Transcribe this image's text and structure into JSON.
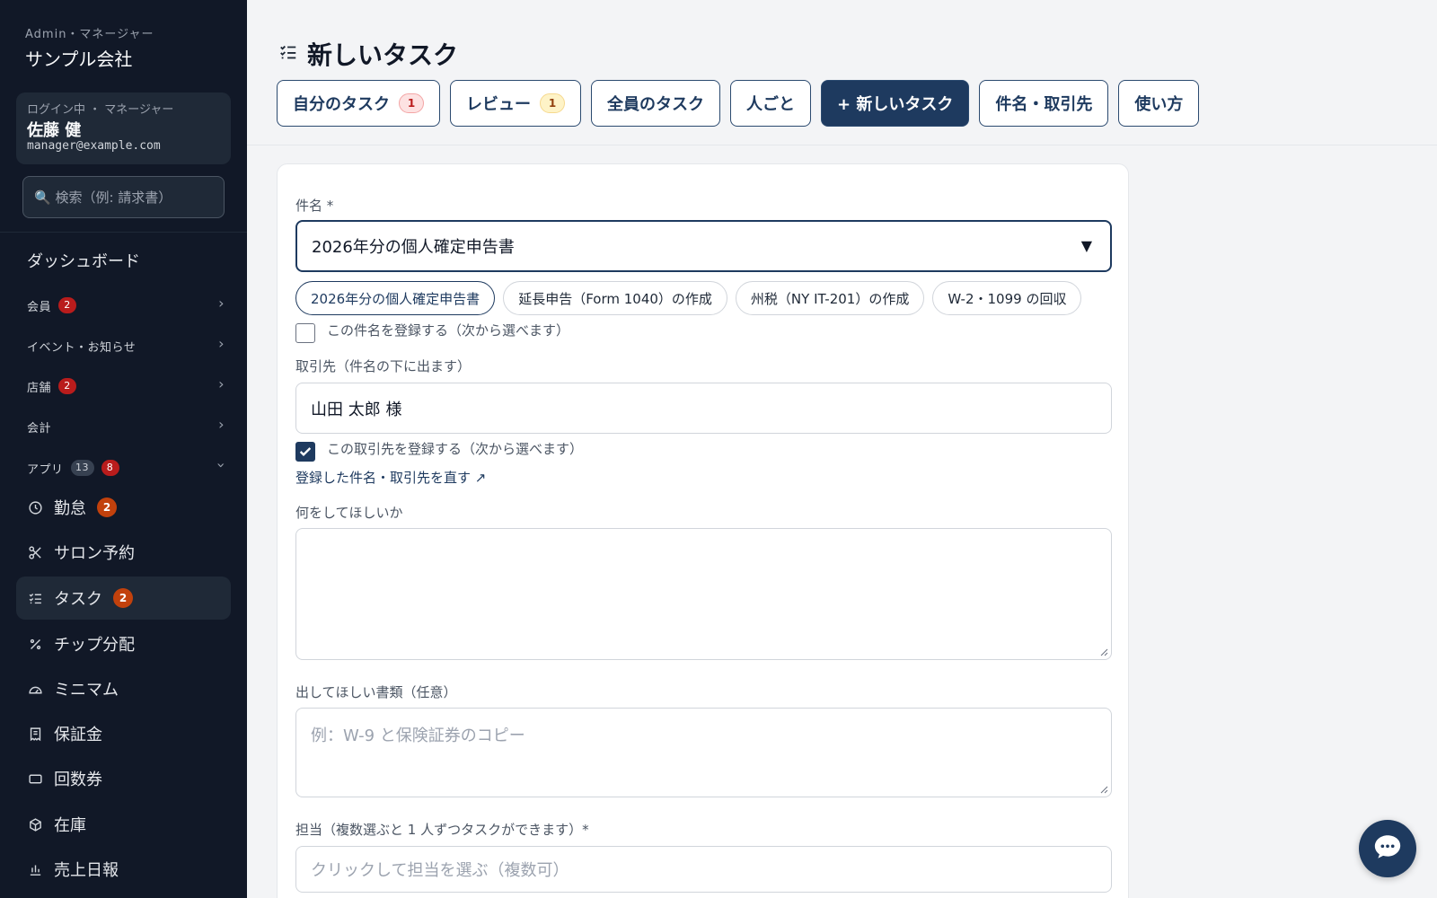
{
  "sidebar": {
    "org_role": "Admin・マネージャー",
    "org_name": "サンプル会社",
    "user": {
      "status": "ログイン中 ・ マネージャー",
      "name": "佐藤 健",
      "email": "manager@example.com"
    },
    "search_placeholder": "🔍 検索（例: 請求書）",
    "dashboard": "ダッシュボード",
    "sections": [
      {
        "label": "会員",
        "badge": "2"
      },
      {
        "label": "イベント・お知らせ"
      },
      {
        "label": "店舗",
        "badge": "2"
      },
      {
        "label": "会計"
      },
      {
        "label": "アプリ",
        "count": "13",
        "badge": "8"
      }
    ],
    "apps": [
      {
        "label": "勤怠",
        "icon": "clock-icon",
        "badge": "2"
      },
      {
        "label": "サロン予約",
        "icon": "scissors-icon"
      },
      {
        "label": "タスク",
        "icon": "checklist-icon",
        "badge": "2",
        "active": true
      },
      {
        "label": "チップ分配",
        "icon": "percent-icon"
      },
      {
        "label": "ミニマム",
        "icon": "gauge-icon"
      },
      {
        "label": "保証金",
        "icon": "receipt-icon"
      },
      {
        "label": "回数券",
        "icon": "ticket-icon"
      },
      {
        "label": "在庫",
        "icon": "box-icon"
      },
      {
        "label": "売上日報",
        "icon": "bar-chart-icon"
      }
    ]
  },
  "header": {
    "title": "新しいタスク",
    "tabs": [
      {
        "label": "自分のタスク",
        "badge": "1"
      },
      {
        "label": "レビュー",
        "badge": "1"
      },
      {
        "label": "全員のタスク"
      },
      {
        "label": "人ごと"
      },
      {
        "label": "+ 新しいタスク",
        "active": true
      },
      {
        "label": "件名・取引先"
      },
      {
        "label": "使い方"
      }
    ]
  },
  "form": {
    "subject_label": "件名 *",
    "subject_value": "2026年分の個人確定申告書",
    "subject_arrow": "▼",
    "suggestions": [
      "2026年分の個人確定申告書",
      "延長申告（Form 1040）の作成",
      "州税（NY IT-201）の作成",
      "W-2・1099 の回収"
    ],
    "register_subject": "この件名を登録する（次から選べます）",
    "client_label": "取引先（件名の下に出ます）",
    "client_value": "山田 太郎 様",
    "register_client": "この取引先を登録する（次から選べます）",
    "edit_link": "登録した件名・取引先を直す ↗",
    "what_label": "何をしてほしいか",
    "what_value": "",
    "docs_label": "出してほしい書類（任意）",
    "docs_placeholder": "例：W-9 と保険証券のコピー",
    "assignee_label": "担当（複数選ぶと 1 人ずつタスクができます）*",
    "assignee_placeholder": "クリックして担当を選ぶ（複数可）"
  },
  "colors": {
    "sidebar_bg": "#111827",
    "accent": "#1e3a5f",
    "badge_red": "#c2410c"
  }
}
